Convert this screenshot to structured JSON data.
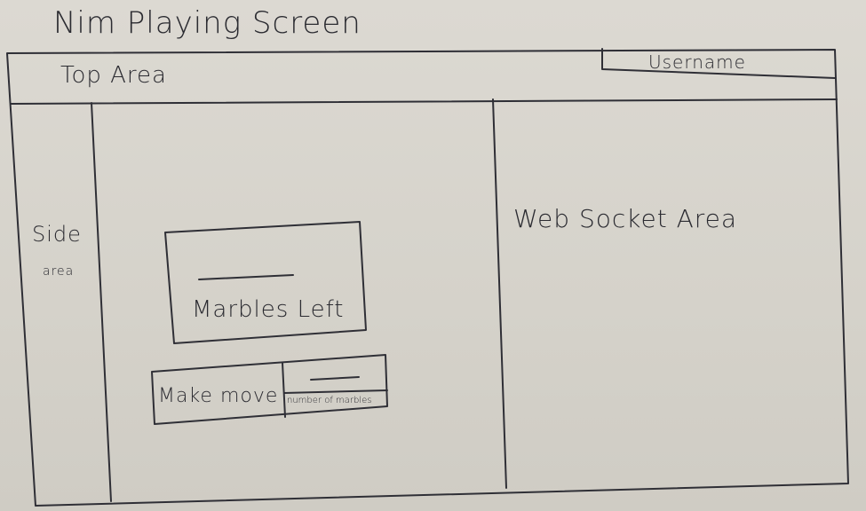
{
  "title": "Nim Playing Screen",
  "top_area": {
    "label": "Top Area"
  },
  "username": {
    "label": "Username"
  },
  "side_area": {
    "label_line1": "Side",
    "label_line2": "area"
  },
  "main": {
    "marbles_left": {
      "value": "",
      "label": "Marbles Left"
    },
    "make_move": {
      "button_label": "Make move",
      "input_value": "",
      "input_caption": "number of marbles"
    }
  },
  "websocket_area": {
    "label": "Web Socket Area"
  }
}
